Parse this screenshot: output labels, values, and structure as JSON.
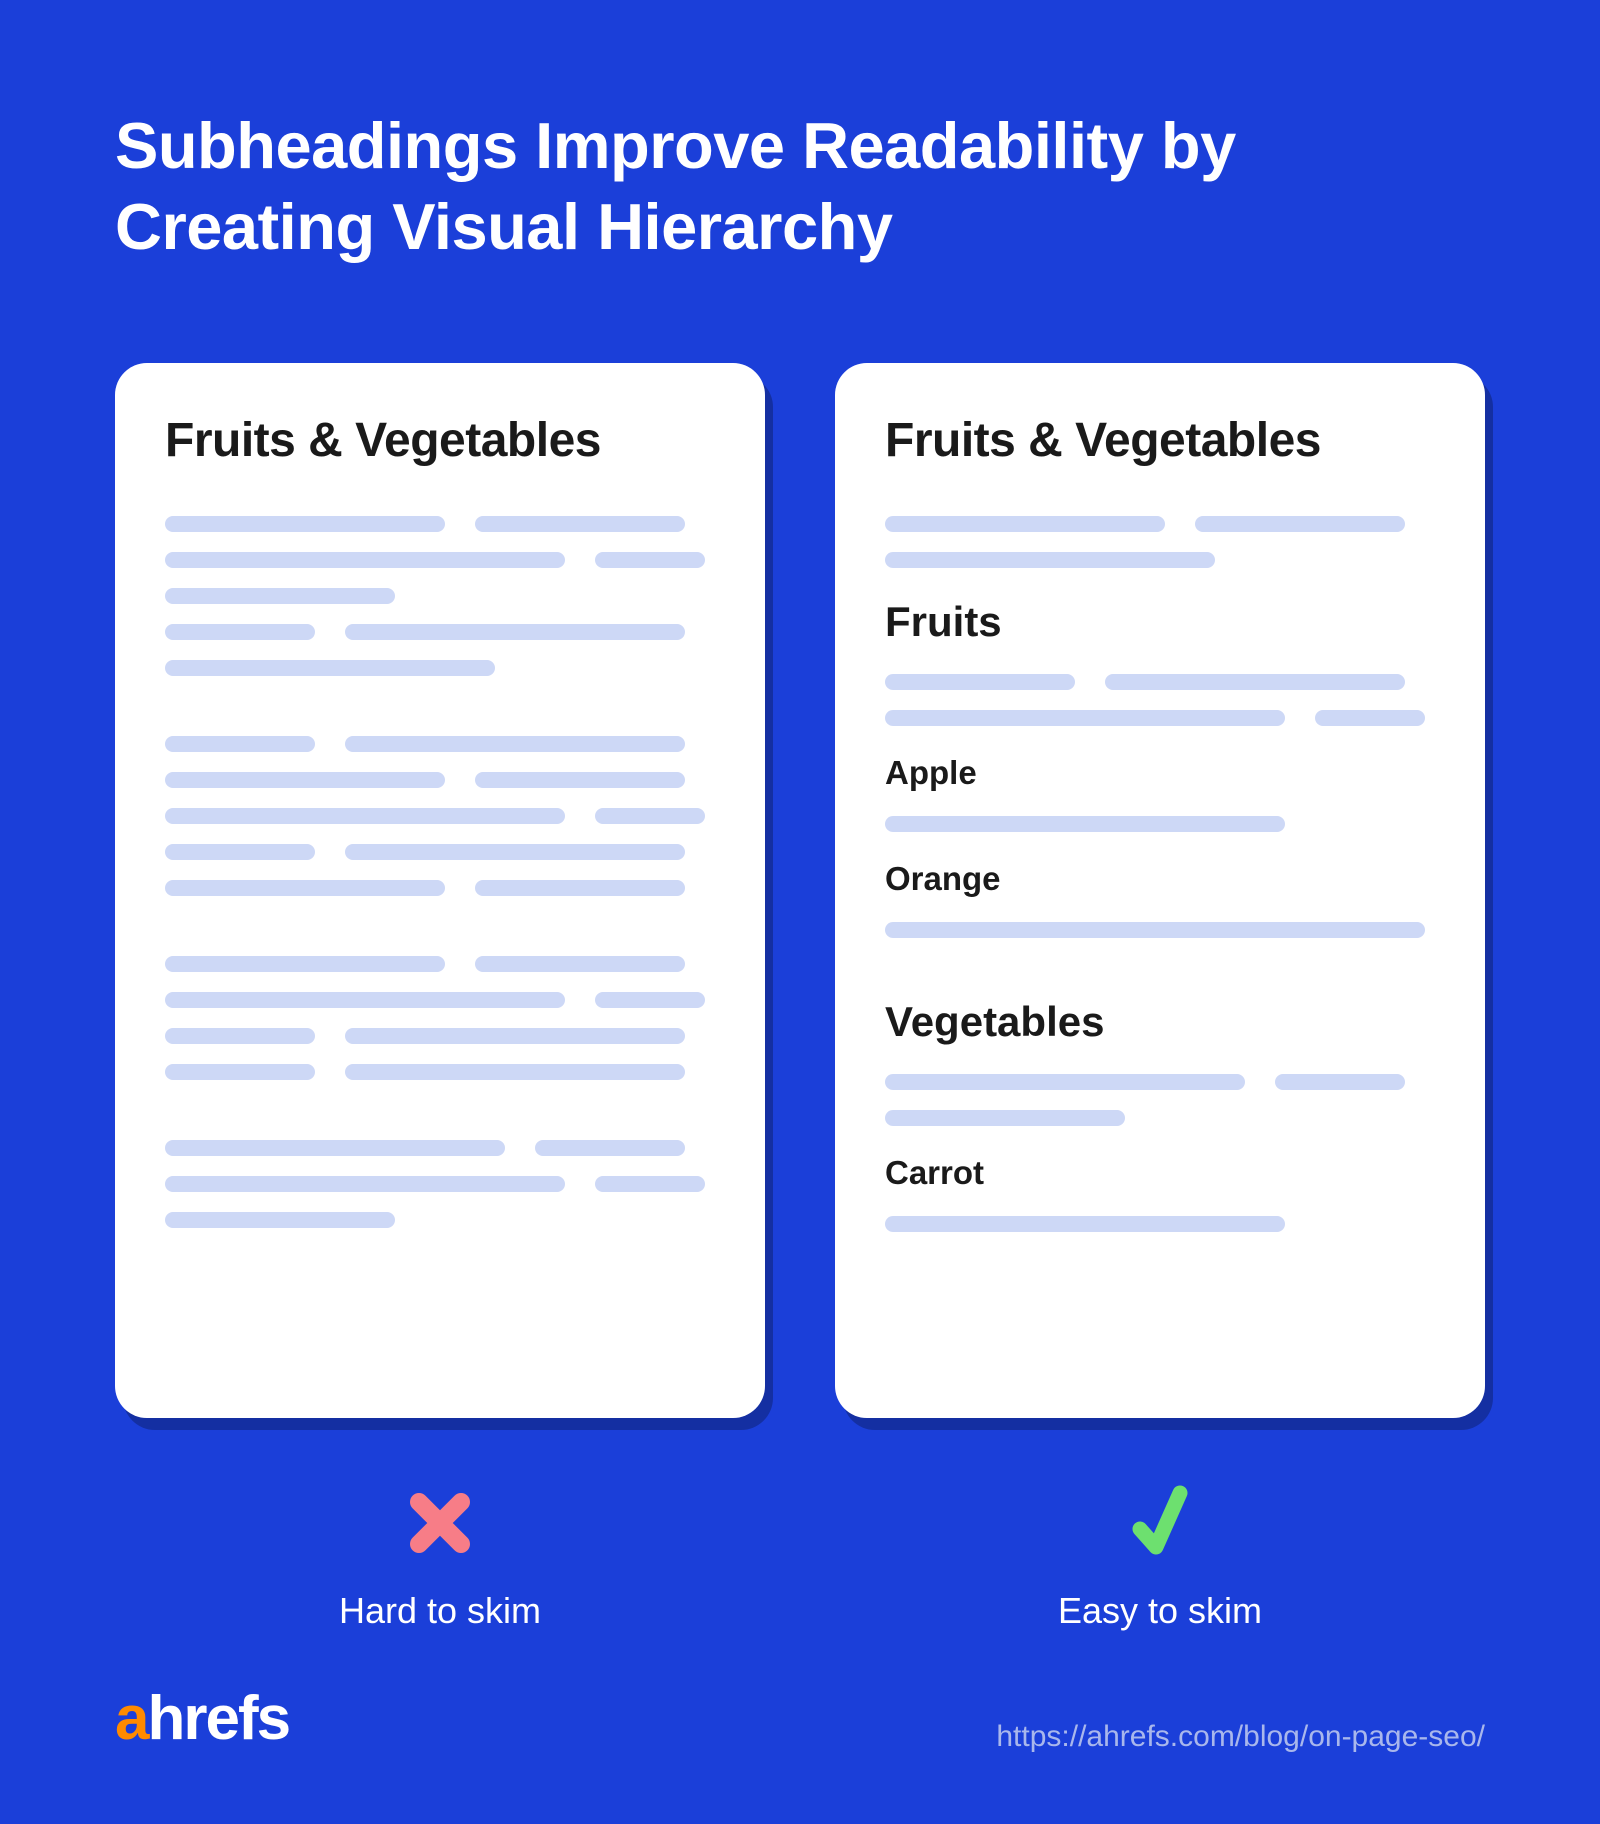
{
  "title": "Subheadings Improve Readability by Creating Visual Hierarchy",
  "left_card": {
    "title": "Fruits & Vegetables"
  },
  "right_card": {
    "title": "Fruits & Vegetables",
    "h2_fruits": "Fruits",
    "h3_apple": "Apple",
    "h3_orange": "Orange",
    "h2_vegetables": "Vegetables",
    "h3_carrot": "Carrot"
  },
  "captions": {
    "left": "Hard to skim",
    "right": "Easy to skim"
  },
  "logo": {
    "a": "a",
    "rest": "hrefs"
  },
  "url": "https://ahrefs.com/blog/on-page-seo/",
  "colors": {
    "background": "#1b3fd9",
    "placeholder": "#cdd8f6",
    "cross": "#f77d87",
    "check": "#6de06f",
    "logo_accent": "#ff8a00"
  }
}
